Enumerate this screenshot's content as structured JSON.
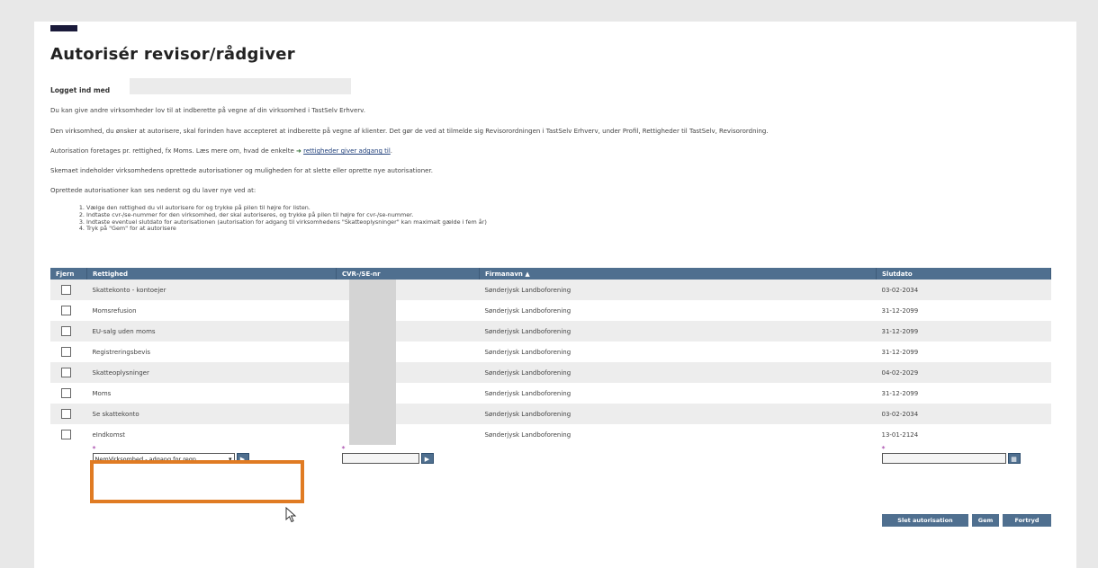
{
  "title": "Autorisér revisor/rådgiver",
  "logged_in_label": "Logget ind med",
  "paragraphs": {
    "p1": "Du kan give andre virksomheder lov til at indberette på vegne af din virksomhed i TastSelv Erhverv.",
    "p2": "Den virksomhed, du ønsker at autorisere, skal forinden have accepteret at indberette på vegne af klienter. Det gør de ved at tilmelde sig Revisorordningen i TastSelv Erhverv, under Profil, Rettigheder til TastSelv, Revisorordning.",
    "p3_before": "Autorisation foretages pr. rettighed, fx Moms. Læs mere om, hvad de enkelte",
    "p3_link": "rettigheder giver adgang til",
    "p4": "Skemaet indeholder virksomhedens oprettede autorisationer og muligheden for at slette eller oprette nye autorisationer.",
    "p5": "Oprettede autorisationer kan ses nederst og du laver nye ved at:"
  },
  "steps": [
    "Vælge den rettighed du vil autorisere for og trykke på pilen til højre for listen.",
    "Indtaste cvr-/se-nummer for den virksomhed, der skal autoriseres, og trykke på pilen til højre for cvr-/se-nummer.",
    "Indtaste eventuel slutdato for autorisationen (autorisation for adgang til virksomhedens \"Skatteoplysninger\" kan maximalt gælde i fem år)",
    "Tryk på \"Gem\" for at autorisere"
  ],
  "table": {
    "headers": {
      "remove": "Fjern",
      "right": "Rettighed",
      "cvr": "CVR-/SE-nr",
      "company": "Firmanavn ▲",
      "end_date": "Slutdato"
    },
    "rows": [
      {
        "right": "Skattekonto - kontoejer",
        "company": "Sønderjysk Landboforening",
        "end_date": "03-02-2034"
      },
      {
        "right": "Momsrefusion",
        "company": "Sønderjysk Landboforening",
        "end_date": "31-12-2099"
      },
      {
        "right": "EU-salg uden moms",
        "company": "Sønderjysk Landboforening",
        "end_date": "31-12-2099"
      },
      {
        "right": "Registreringsbevis",
        "company": "Sønderjysk Landboforening",
        "end_date": "31-12-2099"
      },
      {
        "right": "Skatteoplysninger",
        "company": "Sønderjysk Landboforening",
        "end_date": "04-02-2029"
      },
      {
        "right": "Moms",
        "company": "Sønderjysk Landboforening",
        "end_date": "31-12-2099"
      },
      {
        "right": "Se skattekonto",
        "company": "Sønderjysk Landboforening",
        "end_date": "03-02-2034"
      },
      {
        "right": "eIndkomst",
        "company": "Sønderjysk Landboforening",
        "end_date": "13-01-2124"
      }
    ]
  },
  "form": {
    "required_mark": "*",
    "right_select_value": "NemVirksomhed - adgang for regn",
    "go_glyph": "▶"
  },
  "buttons": {
    "delete": "Slet autorisation",
    "save": "Gem",
    "cancel": "Fortryd"
  },
  "colors": {
    "header_bg": "#4f6f8f",
    "highlight": "#e07b23",
    "required": "#9b2fa0"
  }
}
